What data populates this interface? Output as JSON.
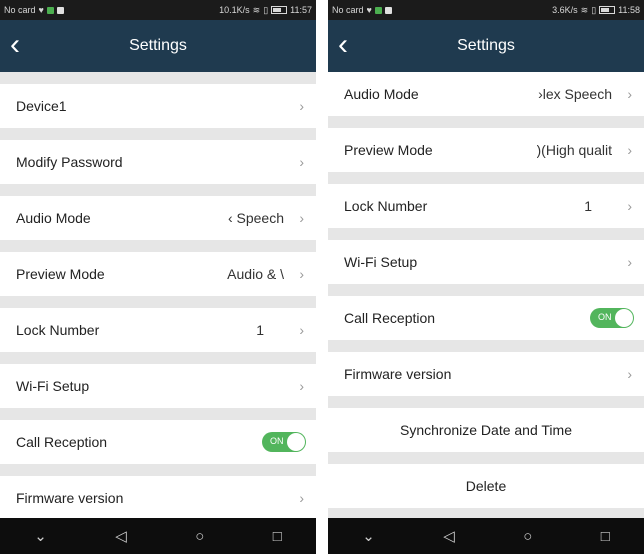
{
  "left": {
    "status": {
      "carrier": "No card",
      "speed": "10.1K/s",
      "battery": "100",
      "time": "11:57"
    },
    "header": {
      "title": "Settings",
      "back_icon": "back-arrow-icon"
    },
    "rows": {
      "device": {
        "label": "Device1"
      },
      "modify_password": {
        "label": "Modify Password"
      },
      "audio_mode": {
        "label": "Audio Mode",
        "value": "‹ Speech"
      },
      "preview_mode": {
        "label": "Preview Mode",
        "value": "Audio & \\"
      },
      "lock_number": {
        "label": "Lock Number",
        "value": "1"
      },
      "wifi_setup": {
        "label": "Wi-Fi Setup"
      },
      "call_reception": {
        "label": "Call Reception",
        "toggle": "ON",
        "toggle_state": true
      },
      "firmware": {
        "label": "Firmware version"
      }
    },
    "navbar": {
      "icons": [
        "chevron-down-icon",
        "back-triangle-icon",
        "home-circle-icon",
        "recent-square-icon"
      ]
    }
  },
  "right": {
    "status": {
      "carrier": "No card",
      "speed": "3.6K/s",
      "battery": "100",
      "time": "11:58"
    },
    "header": {
      "title": "Settings",
      "back_icon": "back-arrow-icon"
    },
    "rows": {
      "audio_mode": {
        "label": "Audio Mode",
        "value": "›lex Speech"
      },
      "preview_mode": {
        "label": "Preview Mode",
        "value": ")(High qualit"
      },
      "lock_number": {
        "label": "Lock Number",
        "value": "1"
      },
      "wifi_setup": {
        "label": "Wi-Fi Setup"
      },
      "call_reception": {
        "label": "Call Reception",
        "toggle": "ON",
        "toggle_state": true
      },
      "firmware": {
        "label": "Firmware version"
      },
      "sync_time": {
        "label": "Synchronize Date and Time"
      },
      "delete": {
        "label": "Delete"
      }
    }
  },
  "chevron": "›",
  "colors": {
    "header_bg": "#1f3a4f",
    "toggle_on": "#52b55c",
    "list_bg": "#e6e6e6",
    "status_bg": "#1b1b1b",
    "nav_bg": "#0d0d0d"
  }
}
